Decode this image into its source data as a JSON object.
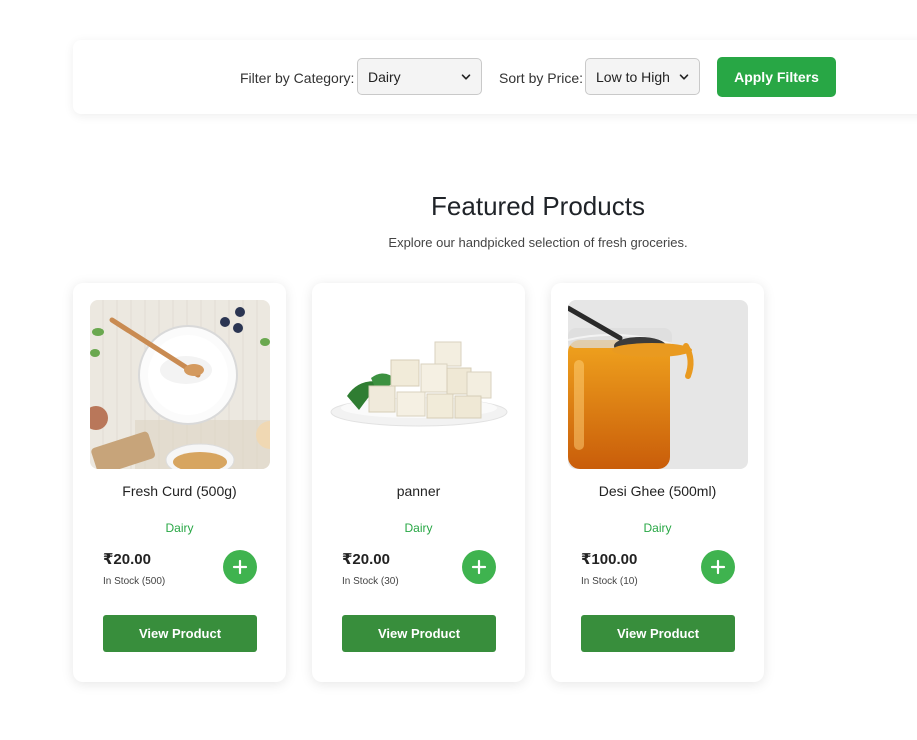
{
  "filters": {
    "category_label": "Filter by Category:",
    "category_value": "Dairy",
    "sort_label": "Sort by Price:",
    "sort_value": "Low to High",
    "apply_label": "Apply Filters"
  },
  "section": {
    "title": "Featured Products",
    "subtitle": "Explore our handpicked selection of fresh groceries."
  },
  "products": [
    {
      "name": "Fresh Curd (500g)",
      "category": "Dairy",
      "price": "₹20.00",
      "stock": "In Stock (500)",
      "view_label": "View Product",
      "image": "curd-bowl-image"
    },
    {
      "name": "panner",
      "category": "Dairy",
      "price": "₹20.00",
      "stock": "In Stock (30)",
      "view_label": "View Product",
      "image": "paneer-cubes-image"
    },
    {
      "name": "Desi Ghee (500ml)",
      "category": "Dairy",
      "price": "₹100.00",
      "stock": "In Stock (10)",
      "view_label": "View Product",
      "image": "ghee-jar-image"
    }
  ],
  "colors": {
    "primary_green": "#28a745",
    "button_green": "#388e3c",
    "add_green": "#3fb34f"
  }
}
